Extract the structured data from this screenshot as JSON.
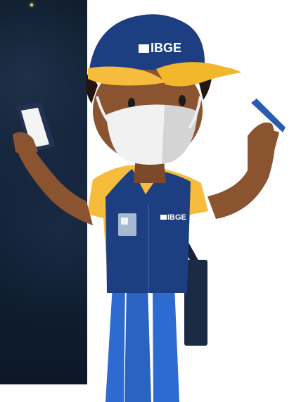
{
  "cap_logo": {
    "text": "IBGE"
  },
  "vest_logo": {
    "text": "IBGE"
  },
  "colors": {
    "night_bg": "#0d1a2b",
    "cap": "#1d3f82",
    "cap_brim": "#f3b72d",
    "vest": "#1d3f82",
    "shirt": "#f6bc3c",
    "skin": "#8a5431",
    "mask": "#f1f1f1",
    "pants": "#2e6bd0"
  }
}
